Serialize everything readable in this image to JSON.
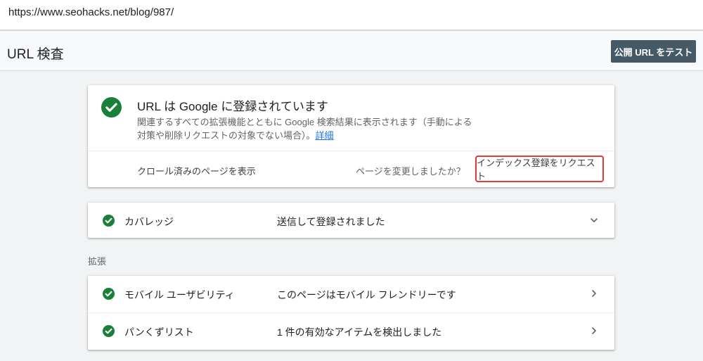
{
  "browser": {
    "url": "https://www.seohacks.net/blog/987/"
  },
  "header": {
    "title": "URL 検査",
    "test_button": "公開 URL をテスト"
  },
  "status_card": {
    "title": "URL は Google に登録されています",
    "description": "関連するすべての拡張機能とともに Google 検索結果に表示されます（手動による対策や削除リクエストの対象でない場合）。",
    "details_link": "詳細",
    "crawled_page_link": "クロール済みのページを表示",
    "changed_question": "ページを変更しましたか？",
    "request_indexing": "インデックス登録をリクエスト"
  },
  "coverage": {
    "label": "カバレッジ",
    "value": "送信して登録されました"
  },
  "enhancements": {
    "section_label": "拡張",
    "rows": [
      {
        "label": "モバイル ユーザビリティ",
        "value": "このページはモバイル フレンドリーです"
      },
      {
        "label": "パンくずリスト",
        "value": "1 件の有効なアイテムを検出しました"
      }
    ]
  },
  "colors": {
    "success_green": "#188038",
    "button_bg": "#455a64",
    "highlight_red": "#e53935"
  }
}
